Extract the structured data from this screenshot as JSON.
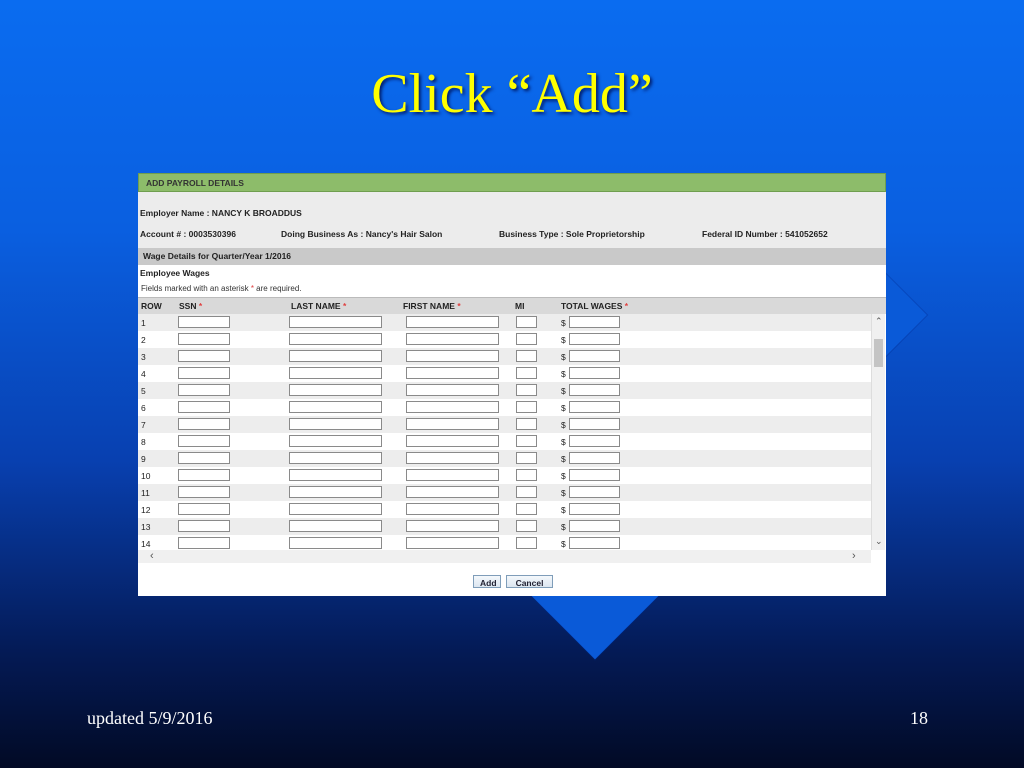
{
  "slide": {
    "title": "Click “Add”",
    "footer_left": "updated 5/9/2016",
    "page_number": "18"
  },
  "form": {
    "header": "ADD PAYROLL DETAILS",
    "employer_name": "Employer Name  : NANCY K BROADDUS",
    "account": "Account # : 0003530396",
    "dba": "Doing Business As : Nancy's Hair Salon",
    "business_type": "Business Type :  Sole Proprietorship",
    "federal_id": "Federal ID Number : 541052652",
    "wage_details": "Wage Details for Quarter/Year   1/2016",
    "employee_wages": "Employee Wages",
    "required_note_pre": "Fields marked with an asterisk ",
    "required_note_ast": "*",
    "required_note_post": " are required.",
    "columns": {
      "row": "ROW",
      "ssn": "SSN",
      "last_name": "LAST NAME",
      "first_name": "FIRST NAME",
      "mi": "MI",
      "total_wages": "TOTAL WAGES",
      "asterisk": "*"
    },
    "currency": "$",
    "rows": [
      "1",
      "2",
      "3",
      "4",
      "5",
      "6",
      "7",
      "8",
      "9",
      "10",
      "11",
      "12",
      "13",
      "14"
    ],
    "buttons": {
      "add": "Add",
      "cancel": "Cancel"
    }
  },
  "colors": {
    "header_green": "#8dbc6a",
    "title_yellow": "#ffff00",
    "asterisk_red": "#e04040"
  }
}
